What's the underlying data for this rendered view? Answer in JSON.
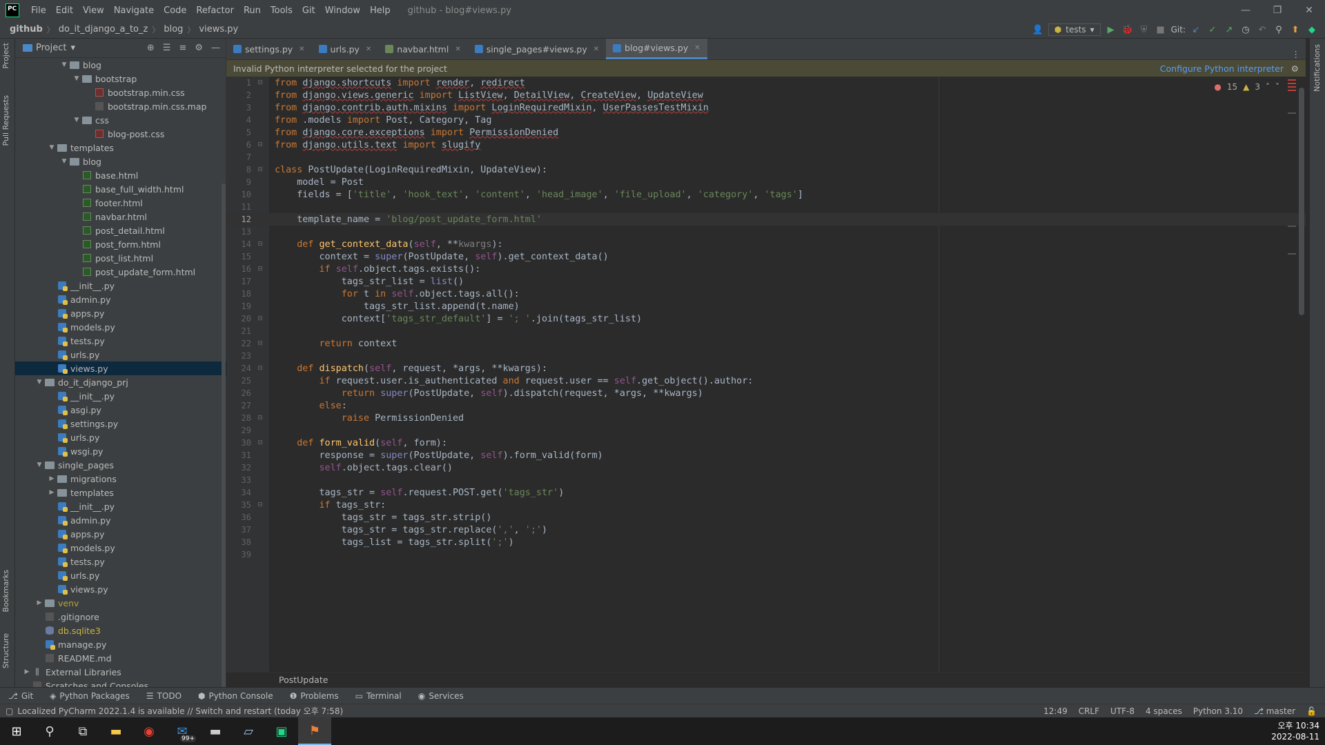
{
  "menubar": {
    "logo": "PC",
    "items": [
      "File",
      "Edit",
      "View",
      "Navigate",
      "Code",
      "Refactor",
      "Run",
      "Tools",
      "Git",
      "Window",
      "Help"
    ],
    "window_title": "github - blog#views.py"
  },
  "navbar": {
    "breadcrumbs": [
      "github",
      "do_it_django_a_to_z",
      "blog",
      "views.py"
    ],
    "run_config": "tests",
    "git_label": "Git:"
  },
  "left_strip": {
    "project": "Project",
    "pull_requests": "Pull Requests",
    "bookmarks": "Bookmarks",
    "structure": "Structure"
  },
  "right_strip": {
    "notifications": "Notifications"
  },
  "project_panel": {
    "title": "Project",
    "tree": [
      {
        "depth": 4,
        "arrow": "open",
        "type": "folder",
        "label": "blog"
      },
      {
        "depth": 5,
        "arrow": "open",
        "type": "folder",
        "label": "bootstrap"
      },
      {
        "depth": 6,
        "arrow": "",
        "type": "css",
        "label": "bootstrap.min.css"
      },
      {
        "depth": 6,
        "arrow": "",
        "type": "txt",
        "label": "bootstrap.min.css.map"
      },
      {
        "depth": 5,
        "arrow": "open",
        "type": "folder",
        "label": "css"
      },
      {
        "depth": 6,
        "arrow": "",
        "type": "css",
        "label": "blog-post.css"
      },
      {
        "depth": 3,
        "arrow": "open",
        "type": "folder",
        "label": "templates"
      },
      {
        "depth": 4,
        "arrow": "open",
        "type": "folder",
        "label": "blog"
      },
      {
        "depth": 5,
        "arrow": "",
        "type": "html",
        "label": "base.html"
      },
      {
        "depth": 5,
        "arrow": "",
        "type": "html",
        "label": "base_full_width.html"
      },
      {
        "depth": 5,
        "arrow": "",
        "type": "html",
        "label": "footer.html"
      },
      {
        "depth": 5,
        "arrow": "",
        "type": "html",
        "label": "navbar.html"
      },
      {
        "depth": 5,
        "arrow": "",
        "type": "html",
        "label": "post_detail.html"
      },
      {
        "depth": 5,
        "arrow": "",
        "type": "html",
        "label": "post_form.html"
      },
      {
        "depth": 5,
        "arrow": "",
        "type": "html",
        "label": "post_list.html"
      },
      {
        "depth": 5,
        "arrow": "",
        "type": "html",
        "label": "post_update_form.html"
      },
      {
        "depth": 3,
        "arrow": "",
        "type": "py",
        "label": "__init__.py"
      },
      {
        "depth": 3,
        "arrow": "",
        "type": "py",
        "label": "admin.py"
      },
      {
        "depth": 3,
        "arrow": "",
        "type": "py",
        "label": "apps.py"
      },
      {
        "depth": 3,
        "arrow": "",
        "type": "py",
        "label": "models.py"
      },
      {
        "depth": 3,
        "arrow": "",
        "type": "py",
        "label": "tests.py"
      },
      {
        "depth": 3,
        "arrow": "",
        "type": "py",
        "label": "urls.py"
      },
      {
        "depth": 3,
        "arrow": "",
        "type": "py",
        "label": "views.py",
        "selected": true
      },
      {
        "depth": 2,
        "arrow": "open",
        "type": "folder",
        "label": "do_it_django_prj"
      },
      {
        "depth": 3,
        "arrow": "",
        "type": "py",
        "label": "__init__.py"
      },
      {
        "depth": 3,
        "arrow": "",
        "type": "py",
        "label": "asgi.py"
      },
      {
        "depth": 3,
        "arrow": "",
        "type": "py",
        "label": "settings.py"
      },
      {
        "depth": 3,
        "arrow": "",
        "type": "py",
        "label": "urls.py"
      },
      {
        "depth": 3,
        "arrow": "",
        "type": "py",
        "label": "wsgi.py"
      },
      {
        "depth": 2,
        "arrow": "open",
        "type": "folder",
        "label": "single_pages"
      },
      {
        "depth": 3,
        "arrow": "closed",
        "type": "folder",
        "label": "migrations"
      },
      {
        "depth": 3,
        "arrow": "closed",
        "type": "folder",
        "label": "templates"
      },
      {
        "depth": 3,
        "arrow": "",
        "type": "py",
        "label": "__init__.py"
      },
      {
        "depth": 3,
        "arrow": "",
        "type": "py",
        "label": "admin.py"
      },
      {
        "depth": 3,
        "arrow": "",
        "type": "py",
        "label": "apps.py"
      },
      {
        "depth": 3,
        "arrow": "",
        "type": "py",
        "label": "models.py"
      },
      {
        "depth": 3,
        "arrow": "",
        "type": "py",
        "label": "tests.py"
      },
      {
        "depth": 3,
        "arrow": "",
        "type": "py",
        "label": "urls.py"
      },
      {
        "depth": 3,
        "arrow": "",
        "type": "py",
        "label": "views.py"
      },
      {
        "depth": 2,
        "arrow": "closed",
        "type": "folder",
        "label": "venv",
        "style": "venv"
      },
      {
        "depth": 2,
        "arrow": "",
        "type": "txt",
        "label": ".gitignore"
      },
      {
        "depth": 2,
        "arrow": "",
        "type": "db",
        "label": "db.sqlite3",
        "style": "dbtxt"
      },
      {
        "depth": 2,
        "arrow": "",
        "type": "py",
        "label": "manage.py"
      },
      {
        "depth": 2,
        "arrow": "",
        "type": "txt",
        "label": "README.md"
      },
      {
        "depth": 1,
        "arrow": "closed",
        "type": "lib",
        "label": "External Libraries"
      },
      {
        "depth": 1,
        "arrow": "",
        "type": "txt",
        "label": "Scratches and Consoles"
      }
    ]
  },
  "tabs": [
    {
      "label": "settings.py",
      "active": false,
      "color": "#3b7bbf"
    },
    {
      "label": "urls.py",
      "active": false,
      "color": "#3b7bbf"
    },
    {
      "label": "navbar.html",
      "active": false,
      "color": "#6a8759"
    },
    {
      "label": "single_pages#views.py",
      "active": false,
      "color": "#3b7bbf"
    },
    {
      "label": "blog#views.py",
      "active": true,
      "color": "#3b7bbf"
    }
  ],
  "banner": {
    "message": "Invalid Python interpreter selected for the project",
    "action": "Configure Python interpreter"
  },
  "inspections": {
    "errors": "15",
    "warnings": "3"
  },
  "code_lines": [
    "<span class=\"kw\">from</span> <span class=\"ul\">django.shortcuts</span> <span class=\"kw\">import</span> <span class=\"ul\">render</span>, <span class=\"ul\">redirect</span>",
    "<span class=\"kw\">from</span> <span class=\"ul\">django.views.generic</span> <span class=\"kw\">import</span> <span class=\"ul\">ListView</span>, <span class=\"ul\">DetailView</span>, <span class=\"ul\">CreateView</span>, <span class=\"ul\">UpdateView</span>",
    "<span class=\"kw\">from</span> <span class=\"ul\">django.contrib.auth.mixins</span> <span class=\"kw\">import</span> <span class=\"ul\">LoginRequiredMixin</span>, <span class=\"ul\">UserPassesTestMixin</span>",
    "<span class=\"kw\">from</span> .models <span class=\"kw\">import</span> Post, Category, Tag",
    "<span class=\"kw\">from</span> <span class=\"ul\">django.core.exceptions</span> <span class=\"kw\">import</span> <span class=\"ul\">PermissionDenied</span>",
    "<span class=\"kw\">from</span> <span class=\"ul\">django.utils.text</span> <span class=\"kw\">import</span> <span class=\"ul\">slugify</span>",
    "",
    "<span class=\"kw\">class</span> PostUpdate(LoginRequiredMixin, UpdateView):",
    "    model = Post",
    "    fields = [<span class=\"str\">'title'</span>, <span class=\"str\">'hook_text'</span>, <span class=\"str\">'content'</span>, <span class=\"str\">'head_image'</span>, <span class=\"str\">'file_upload'</span>, <span class=\"str\">'category'</span>, <span class=\"str\">'tags'</span>]",
    "",
    "    template_name = <span class=\"str\">'blog/post_update_form.html'</span>",
    "",
    "    <span class=\"kw\">def</span> <span class=\"fn\">get_context_data</span>(<span class=\"slf\">self</span>, **<span class=\"gr\">kwargs</span>):",
    "        context = <span class=\"bi\">super</span>(PostUpdate, <span class=\"slf\">self</span>).get_context_data()",
    "        <span class=\"kw\">if</span> <span class=\"slf\">self</span>.object.tags.exists():",
    "            tags_str_list = <span class=\"bi\">list</span>()",
    "            <span class=\"kw\">for</span> t <span class=\"kw\">in</span> <span class=\"slf\">self</span>.object.tags.all():",
    "                tags_str_list.append(t.name)",
    "            context[<span class=\"str\">'tags_str_default'</span>] = <span class=\"str\">'; '</span>.join(tags_str_list)",
    "",
    "        <span class=\"kw\">return</span> context",
    "",
    "    <span class=\"kw\">def</span> <span class=\"fn\">dispatch</span>(<span class=\"slf\">self</span>, request, *args, **kwargs):",
    "        <span class=\"kw\">if</span> request.user.is_authenticated <span class=\"kw\">and</span> request.user == <span class=\"slf\">self</span>.get_object().author:",
    "            <span class=\"kw\">return</span> <span class=\"bi\">super</span>(PostUpdate, <span class=\"slf\">self</span>).dispatch(request, *args, **kwargs)",
    "        <span class=\"kw\">else</span>:",
    "            <span class=\"kw\">raise</span> PermissionDenied",
    "",
    "    <span class=\"kw\">def</span> <span class=\"fn\">form_valid</span>(<span class=\"slf\">self</span>, form):",
    "        response = <span class=\"bi\">super</span>(PostUpdate, <span class=\"slf\">self</span>).form_valid(form)",
    "        <span class=\"slf\">self</span>.object.tags.clear()",
    "",
    "        tags_str = <span class=\"slf\">self</span>.request.POST.get(<span class=\"str\">'tags_str'</span>)",
    "        <span class=\"kw\">if</span> tags_str:",
    "            tags_str = tags_str.strip()",
    "            tags_str = tags_str.replace(<span class=\"str\">','</span>, <span class=\"str\">';'</span>)",
    "            tags_list = tags_str.split(<span class=\"str\">';'</span>)",
    ""
  ],
  "current_line": 12,
  "fold_lines": [
    1,
    6,
    8,
    14,
    16,
    20,
    22,
    24,
    28,
    30,
    35
  ],
  "breadcrumb_bottom": "PostUpdate",
  "tool_windows": [
    "Git",
    "Python Packages",
    "TODO",
    "Python Console",
    "Problems",
    "Terminal",
    "Services"
  ],
  "status": {
    "message": "Localized PyCharm 2022.1.4 is available // Switch and restart (today 오후 7:58)",
    "position": "12:49",
    "line_sep": "CRLF",
    "encoding": "UTF-8",
    "indent": "4 spaces",
    "interpreter": "Python 3.10",
    "branch": "master"
  },
  "taskbar": {
    "time": "오후 10:34",
    "date": "2022-08-11",
    "mail_badge": "99+"
  }
}
